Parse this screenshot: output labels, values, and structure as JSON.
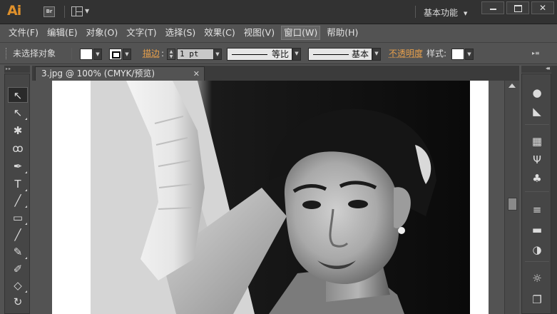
{
  "titlebar": {
    "app_logo": "Ai",
    "bridge_label": "Br",
    "workspace_label": "基本功能",
    "close_glyph": "✕"
  },
  "menu": {
    "items": [
      {
        "label": "文件(F)"
      },
      {
        "label": "编辑(E)"
      },
      {
        "label": "对象(O)"
      },
      {
        "label": "文字(T)"
      },
      {
        "label": "选择(S)"
      },
      {
        "label": "效果(C)"
      },
      {
        "label": "视图(V)"
      },
      {
        "label": "窗口(W)",
        "active": true
      },
      {
        "label": "帮助(H)"
      }
    ]
  },
  "control": {
    "selection_status": "未选择对象",
    "stroke_label": "描边",
    "stroke_weight": "1 pt",
    "stroke_profile_label": "等比",
    "brush_label": "基本",
    "opacity_label": "不透明度",
    "style_label": "样式:"
  },
  "document": {
    "tab_title": "3.jpg @ 100% (CMYK/预览)",
    "tab_close": "✕"
  },
  "tools": [
    {
      "name": "selection-tool",
      "glyph": "↖",
      "selected": true
    },
    {
      "name": "direct-selection-tool",
      "glyph": "↖"
    },
    {
      "name": "magic-wand-tool",
      "glyph": "✱"
    },
    {
      "name": "lasso-tool",
      "glyph": "ꝏ"
    },
    {
      "name": "pen-tool",
      "glyph": "✒"
    },
    {
      "name": "type-tool",
      "glyph": "T"
    },
    {
      "name": "line-segment-tool",
      "glyph": "╱"
    },
    {
      "name": "rectangle-tool",
      "glyph": "▭"
    },
    {
      "name": "paintbrush-tool",
      "glyph": "╱"
    },
    {
      "name": "pencil-tool",
      "glyph": "✎"
    },
    {
      "name": "blob-brush-tool",
      "glyph": "✐"
    },
    {
      "name": "eraser-tool",
      "glyph": "◇"
    },
    {
      "name": "rotate-tool",
      "glyph": "↻"
    }
  ],
  "dock": [
    {
      "name": "color-panel",
      "glyph": "🎨"
    },
    {
      "name": "color-guide-panel",
      "glyph": "◣"
    },
    {
      "name": "swatches-panel",
      "glyph": "▦"
    },
    {
      "name": "brushes-panel",
      "glyph": "Ψ"
    },
    {
      "name": "symbols-panel",
      "glyph": "♣"
    },
    {
      "name": "stroke-panel",
      "glyph": "≡"
    },
    {
      "name": "gradient-panel",
      "glyph": "▬"
    },
    {
      "name": "transparency-panel",
      "glyph": "◑"
    },
    {
      "name": "appearance-panel",
      "glyph": "☼"
    },
    {
      "name": "layers-panel",
      "glyph": "❐"
    }
  ]
}
